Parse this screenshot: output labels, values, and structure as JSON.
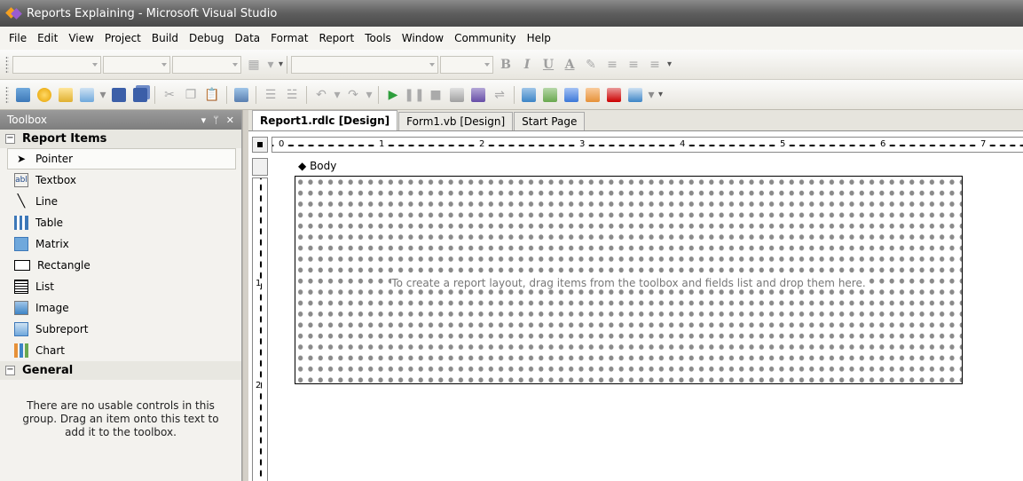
{
  "window": {
    "title": "Reports Explaining - Microsoft Visual Studio"
  },
  "menu": [
    "File",
    "Edit",
    "View",
    "Project",
    "Build",
    "Debug",
    "Data",
    "Format",
    "Report",
    "Tools",
    "Window",
    "Community",
    "Help"
  ],
  "toolbar_format": {
    "bold": "B",
    "italic": "I",
    "underline": "U",
    "font_color": "A"
  },
  "toolbox": {
    "title": "Toolbox",
    "pin_label": "▾ ⊥ ✕",
    "report_items_header": "Report Items",
    "items": [
      {
        "label": "Pointer",
        "icon": "pointer-icon"
      },
      {
        "label": "Textbox",
        "icon": "textbox-icon"
      },
      {
        "label": "Line",
        "icon": "line-icon"
      },
      {
        "label": "Table",
        "icon": "table-icon"
      },
      {
        "label": "Matrix",
        "icon": "matrix-icon"
      },
      {
        "label": "Rectangle",
        "icon": "rectangle-icon"
      },
      {
        "label": "List",
        "icon": "list-icon"
      },
      {
        "label": "Image",
        "icon": "image-icon"
      },
      {
        "label": "Subreport",
        "icon": "subreport-icon"
      },
      {
        "label": "Chart",
        "icon": "chart-icon"
      }
    ],
    "general_header": "General",
    "general_hint": "There are no usable controls in this group. Drag an item onto this text to add it to the toolbox."
  },
  "tabs": [
    {
      "label": "Report1.rdlc [Design]",
      "active": true
    },
    {
      "label": "Form1.vb [Design]",
      "active": false
    },
    {
      "label": "Start Page",
      "active": false
    }
  ],
  "designer": {
    "body_label": "Body",
    "hint": "To create a report layout, drag items from the toolbox and fields list and drop them here.",
    "ruler_h": [
      "0",
      "1",
      "2",
      "3",
      "4",
      "5",
      "6",
      "7"
    ],
    "ruler_v": [
      "1",
      "2"
    ]
  }
}
